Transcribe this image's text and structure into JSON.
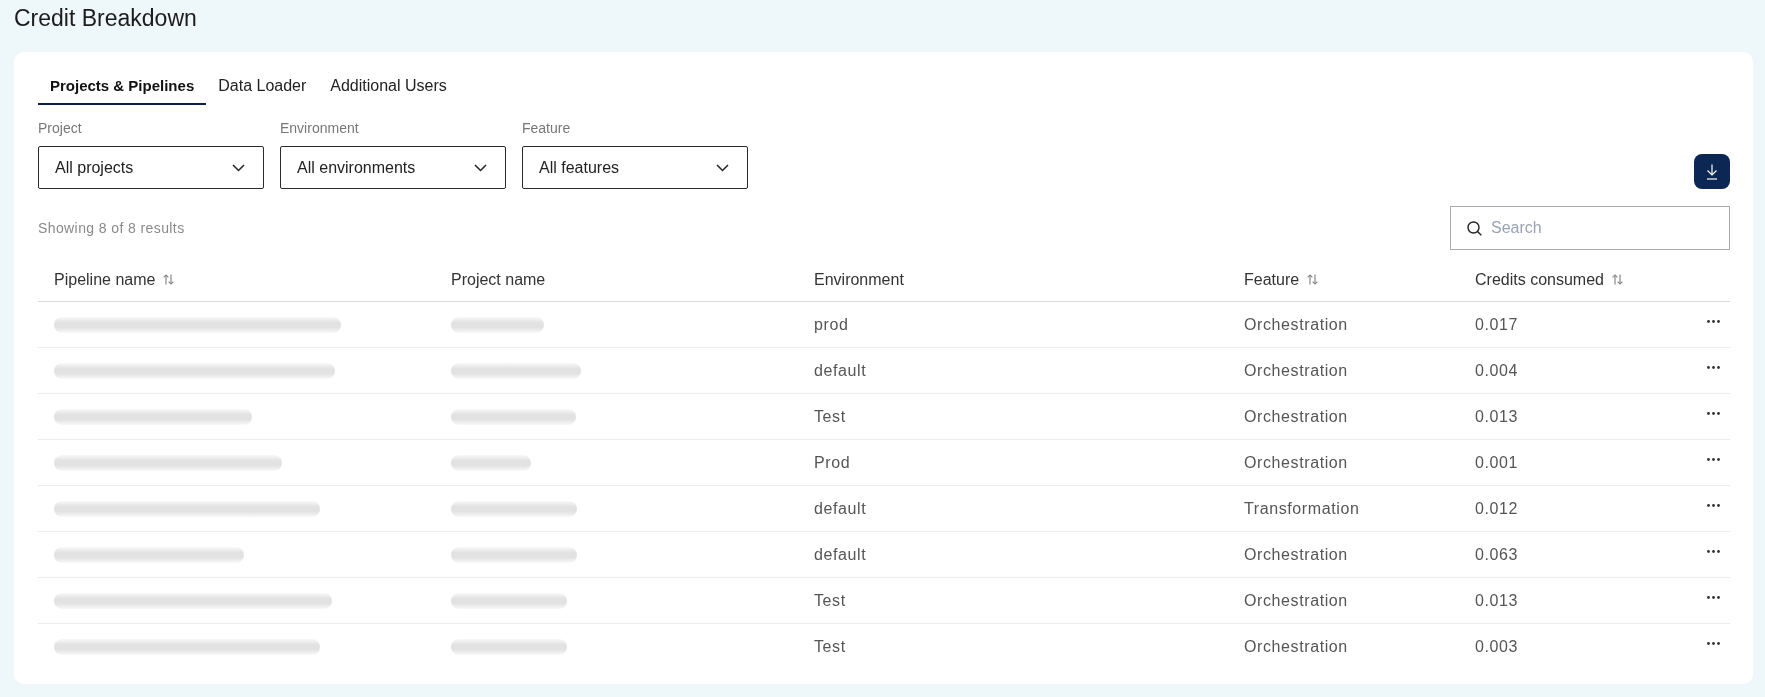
{
  "page": {
    "title": "Credit Breakdown"
  },
  "tabs": [
    {
      "label": "Projects & Pipelines",
      "selected": true
    },
    {
      "label": "Data Loader",
      "selected": false
    },
    {
      "label": "Additional Users",
      "selected": false
    }
  ],
  "filters": [
    {
      "label": "Project",
      "value": "All projects"
    },
    {
      "label": "Environment",
      "value": "All environments"
    },
    {
      "label": "Feature",
      "value": "All features"
    }
  ],
  "results_summary": "Showing 8 of 8 results",
  "search": {
    "placeholder": "Search"
  },
  "table": {
    "columns": [
      {
        "label": "Pipeline name",
        "sortable": true
      },
      {
        "label": "Project name",
        "sortable": false
      },
      {
        "label": "Environment",
        "sortable": false
      },
      {
        "label": "Feature",
        "sortable": true
      },
      {
        "label": "Credits consumed",
        "sortable": true
      }
    ],
    "rows": [
      {
        "environment": "prod",
        "feature": "Orchestration",
        "credits_consumed": "0.017"
      },
      {
        "environment": "default",
        "feature": "Orchestration",
        "credits_consumed": "0.004"
      },
      {
        "environment": "Test",
        "feature": "Orchestration",
        "credits_consumed": "0.013"
      },
      {
        "environment": "Prod",
        "feature": "Orchestration",
        "credits_consumed": "0.001"
      },
      {
        "environment": "default",
        "feature": "Transformation",
        "credits_consumed": "0.012"
      },
      {
        "environment": "default",
        "feature": "Orchestration",
        "credits_consumed": "0.063"
      },
      {
        "environment": "Test",
        "feature": "Orchestration",
        "credits_consumed": "0.013"
      },
      {
        "environment": "Test",
        "feature": "Orchestration",
        "credits_consumed": "0.003"
      }
    ]
  }
}
